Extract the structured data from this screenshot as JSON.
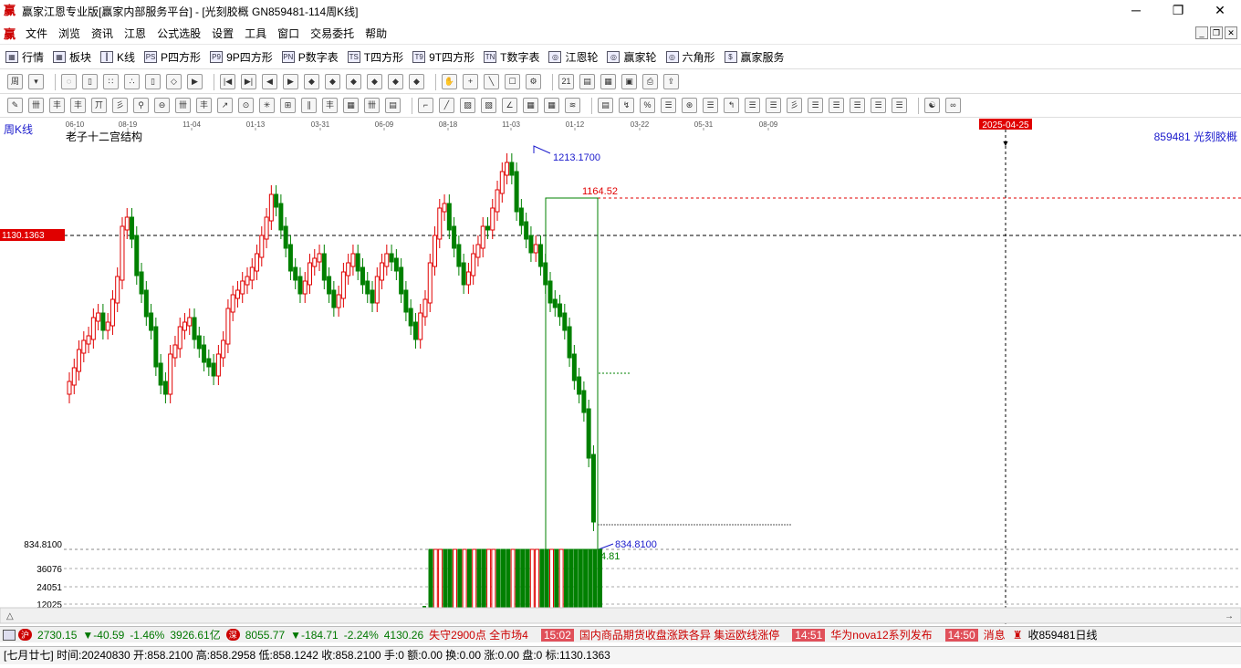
{
  "window": {
    "title": "赢家江恩专业版[赢家内部服务平台] - [光刻胶概  GN859481-114周K线]",
    "minimize": "─",
    "maximize": "❐",
    "close": "✕"
  },
  "menu": {
    "logo": "赢",
    "items": [
      "文件",
      "浏览",
      "资讯",
      "江恩",
      "公式选股",
      "设置",
      "工具",
      "窗口",
      "交易委托",
      "帮助"
    ]
  },
  "toolbar1": {
    "items": [
      {
        "icon": "▦",
        "label": "行情"
      },
      {
        "icon": "▦",
        "label": "板块"
      },
      {
        "icon": "┃",
        "label": "K线"
      },
      {
        "icon": "PS",
        "label": "P四方形"
      },
      {
        "icon": "P9",
        "label": "9P四方形"
      },
      {
        "icon": "PN",
        "label": "P数字表"
      },
      {
        "icon": "TS",
        "label": "T四方形"
      },
      {
        "icon": "T9",
        "label": "9T四方形"
      },
      {
        "icon": "TN",
        "label": "T数字表"
      },
      {
        "icon": "◎",
        "label": "江恩轮"
      },
      {
        "icon": "◎",
        "label": "赢家轮"
      },
      {
        "icon": "◎",
        "label": "六角形"
      },
      {
        "icon": "$",
        "label": "赢家服务"
      }
    ]
  },
  "chart": {
    "period_label": "周K线",
    "indicator_name": "老子十二宫结构",
    "symbol_label": "859481  光刻胶概",
    "date_ticks": [
      "06-10",
      "08-19",
      "11-04",
      "01-13",
      "03-31",
      "06-09",
      "08-18",
      "11-03",
      "01-12",
      "03-22",
      "05-31",
      "08-09"
    ],
    "cursor_date": "2025-04-25",
    "high_label": "1213.1700",
    "level_1164": "1164.52",
    "cursor_price": "1130.1363",
    "low_axis_label": "834.8100",
    "low_label": "834.8100",
    "low_pct": "4.81",
    "volume_ticks": [
      "36076",
      "24051",
      "12025"
    ],
    "colors": {
      "up": "#e00000",
      "down": "#008000",
      "blue": "#1a1acc"
    }
  },
  "ticker": {
    "index1": "2730.15",
    "index1_change": "▼-40.59",
    "index1_pct": "-1.46%",
    "index1_amount": "3926.61亿",
    "index2_badge": "深",
    "index2": "8055.77",
    "index2_change": "▼-184.71",
    "index2_pct": "-2.24%",
    "index2_amount": "4130.26",
    "news1": "失守2900点 全市场4",
    "time2": "15:02",
    "news2": "国内商品期货收盘涨跌各异 集运欧线涨停",
    "time3": "14:51",
    "news3": "华为nova12系列发布",
    "time4": "14:50",
    "news4": "消息",
    "right_label": "收859481日线"
  },
  "status": {
    "text": "[七月廿七] 时间:20240830 开:858.2100 高:858.2958 低:858.1242 收:858.2100 手:0 额:0.00 换:0.00 涨:0.00 盘:0 标:1130.1363"
  }
}
